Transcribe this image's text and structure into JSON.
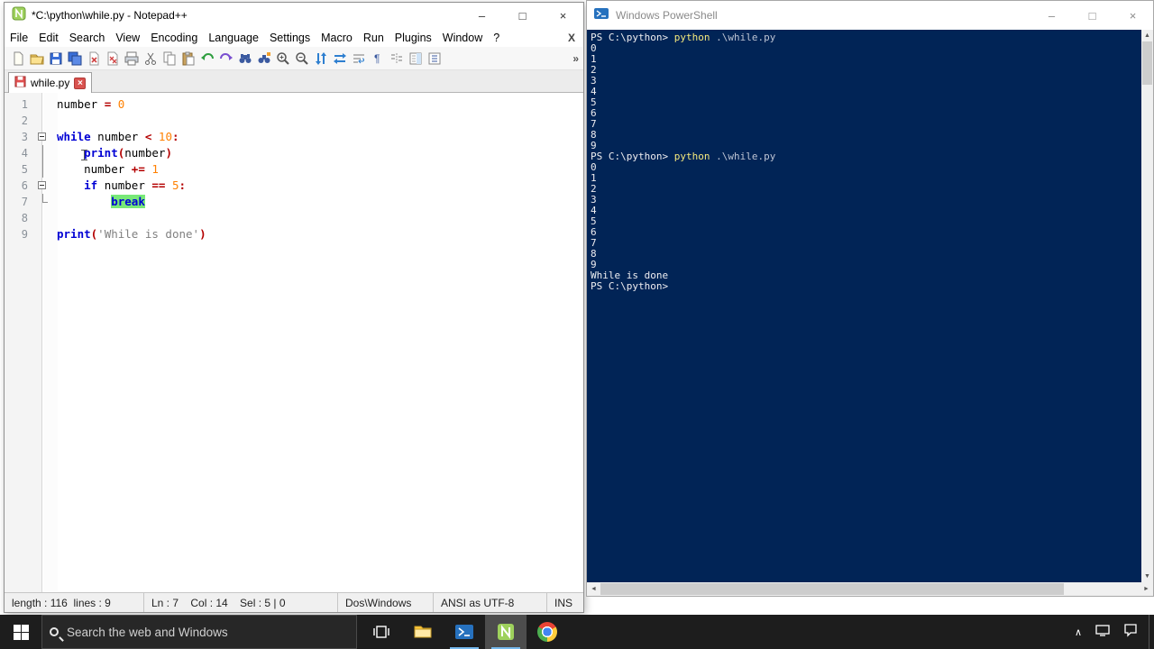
{
  "glyphs": {
    "minimize": "–",
    "maximize": "□",
    "close": "×",
    "menu_overflow": "X",
    "toolbar_overflow": "»",
    "tab_close": "×",
    "scroll_up": "▲",
    "scroll_down": "▼",
    "scroll_left": "◄",
    "scroll_right": "►",
    "tray_chevron": "∧"
  },
  "notepad": {
    "window_title": "*C:\\python\\while.py - Notepad++",
    "menus": [
      "File",
      "Edit",
      "Search",
      "View",
      "Encoding",
      "Language",
      "Settings",
      "Macro",
      "Run",
      "Plugins",
      "Window",
      "?"
    ],
    "toolbar_icons": [
      "new-file",
      "open-file",
      "save",
      "save-all",
      "close",
      "close-all",
      "print",
      "cut",
      "copy",
      "paste",
      "undo",
      "redo",
      "find",
      "replace",
      "zoom-in",
      "zoom-out",
      "sync-vertical-scroll",
      "sync-horizontal-scroll",
      "word-wrap",
      "show-all-characters",
      "indent-guide",
      "document-map",
      "function-list"
    ],
    "tab": {
      "label": "while.py"
    },
    "editor": {
      "lines": [
        {
          "n": "1",
          "fold": "",
          "segs": [
            [
              "number ",
              "d"
            ],
            [
              "= ",
              "o"
            ],
            [
              "0",
              "n"
            ]
          ]
        },
        {
          "n": "2",
          "fold": "",
          "segs": []
        },
        {
          "n": "3",
          "fold": "box",
          "segs": [
            [
              "while",
              "k"
            ],
            [
              " number ",
              "d"
            ],
            [
              "< ",
              "o"
            ],
            [
              "10",
              "n"
            ],
            [
              ":",
              "o"
            ]
          ]
        },
        {
          "n": "4",
          "fold": "line",
          "segs": [
            [
              "    ",
              "d"
            ],
            [
              "print",
              "k"
            ],
            [
              "(",
              "o"
            ],
            [
              "number",
              "d"
            ],
            [
              ")",
              "o"
            ]
          ]
        },
        {
          "n": "5",
          "fold": "line",
          "segs": [
            [
              "    number ",
              "d"
            ],
            [
              "+= ",
              "o"
            ],
            [
              "1",
              "n"
            ]
          ]
        },
        {
          "n": "6",
          "fold": "box",
          "segs": [
            [
              "    ",
              "d"
            ],
            [
              "if",
              "k"
            ],
            [
              " number ",
              "d"
            ],
            [
              "== ",
              "o"
            ],
            [
              "5",
              "n"
            ],
            [
              ":",
              "o"
            ]
          ]
        },
        {
          "n": "7",
          "fold": "end",
          "segs": [
            [
              "        ",
              "d"
            ],
            [
              "break",
              "ksel"
            ]
          ]
        },
        {
          "n": "8",
          "fold": "",
          "segs": []
        },
        {
          "n": "9",
          "fold": "",
          "segs": [
            [
              "print",
              "k"
            ],
            [
              "(",
              "o"
            ],
            [
              "'While is done'",
              "s"
            ],
            [
              ")",
              "o"
            ]
          ]
        }
      ]
    },
    "status": {
      "doc": "length : 116  lines : 9",
      "pos": "Ln : 7    Col : 14    Sel : 5 | 0",
      "eol": "Dos\\Windows",
      "enc": "ANSI as UTF-8",
      "mode": "INS"
    }
  },
  "powershell": {
    "window_title": "Windows PowerShell",
    "lines": [
      [
        [
          "PS C:\\python> ",
          "p"
        ],
        [
          "python",
          "c"
        ],
        [
          " .\\while.py",
          "a"
        ]
      ],
      [
        [
          "0",
          "t"
        ]
      ],
      [
        [
          "1",
          "t"
        ]
      ],
      [
        [
          "2",
          "t"
        ]
      ],
      [
        [
          "3",
          "t"
        ]
      ],
      [
        [
          "4",
          "t"
        ]
      ],
      [
        [
          "5",
          "t"
        ]
      ],
      [
        [
          "6",
          "t"
        ]
      ],
      [
        [
          "7",
          "t"
        ]
      ],
      [
        [
          "8",
          "t"
        ]
      ],
      [
        [
          "9",
          "t"
        ]
      ],
      [
        [
          "PS C:\\python> ",
          "p"
        ],
        [
          "python",
          "c"
        ],
        [
          " .\\while.py",
          "a"
        ]
      ],
      [
        [
          "0",
          "t"
        ]
      ],
      [
        [
          "1",
          "t"
        ]
      ],
      [
        [
          "2",
          "t"
        ]
      ],
      [
        [
          "3",
          "t"
        ]
      ],
      [
        [
          "4",
          "t"
        ]
      ],
      [
        [
          "5",
          "t"
        ]
      ],
      [
        [
          "6",
          "t"
        ]
      ],
      [
        [
          "7",
          "t"
        ]
      ],
      [
        [
          "8",
          "t"
        ]
      ],
      [
        [
          "9",
          "t"
        ]
      ],
      [
        [
          "While is done",
          "t"
        ]
      ],
      [
        [
          "PS C:\\python>",
          "p"
        ]
      ]
    ]
  },
  "taskbar": {
    "search_placeholder": "Search the web and Windows",
    "apps": [
      {
        "name": "task-view",
        "running": false,
        "active": false
      },
      {
        "name": "file-explorer",
        "running": false,
        "active": false
      },
      {
        "name": "powershell",
        "running": true,
        "active": false
      },
      {
        "name": "notepadpp",
        "running": true,
        "active": true
      },
      {
        "name": "chrome",
        "running": false,
        "active": false
      }
    ]
  }
}
